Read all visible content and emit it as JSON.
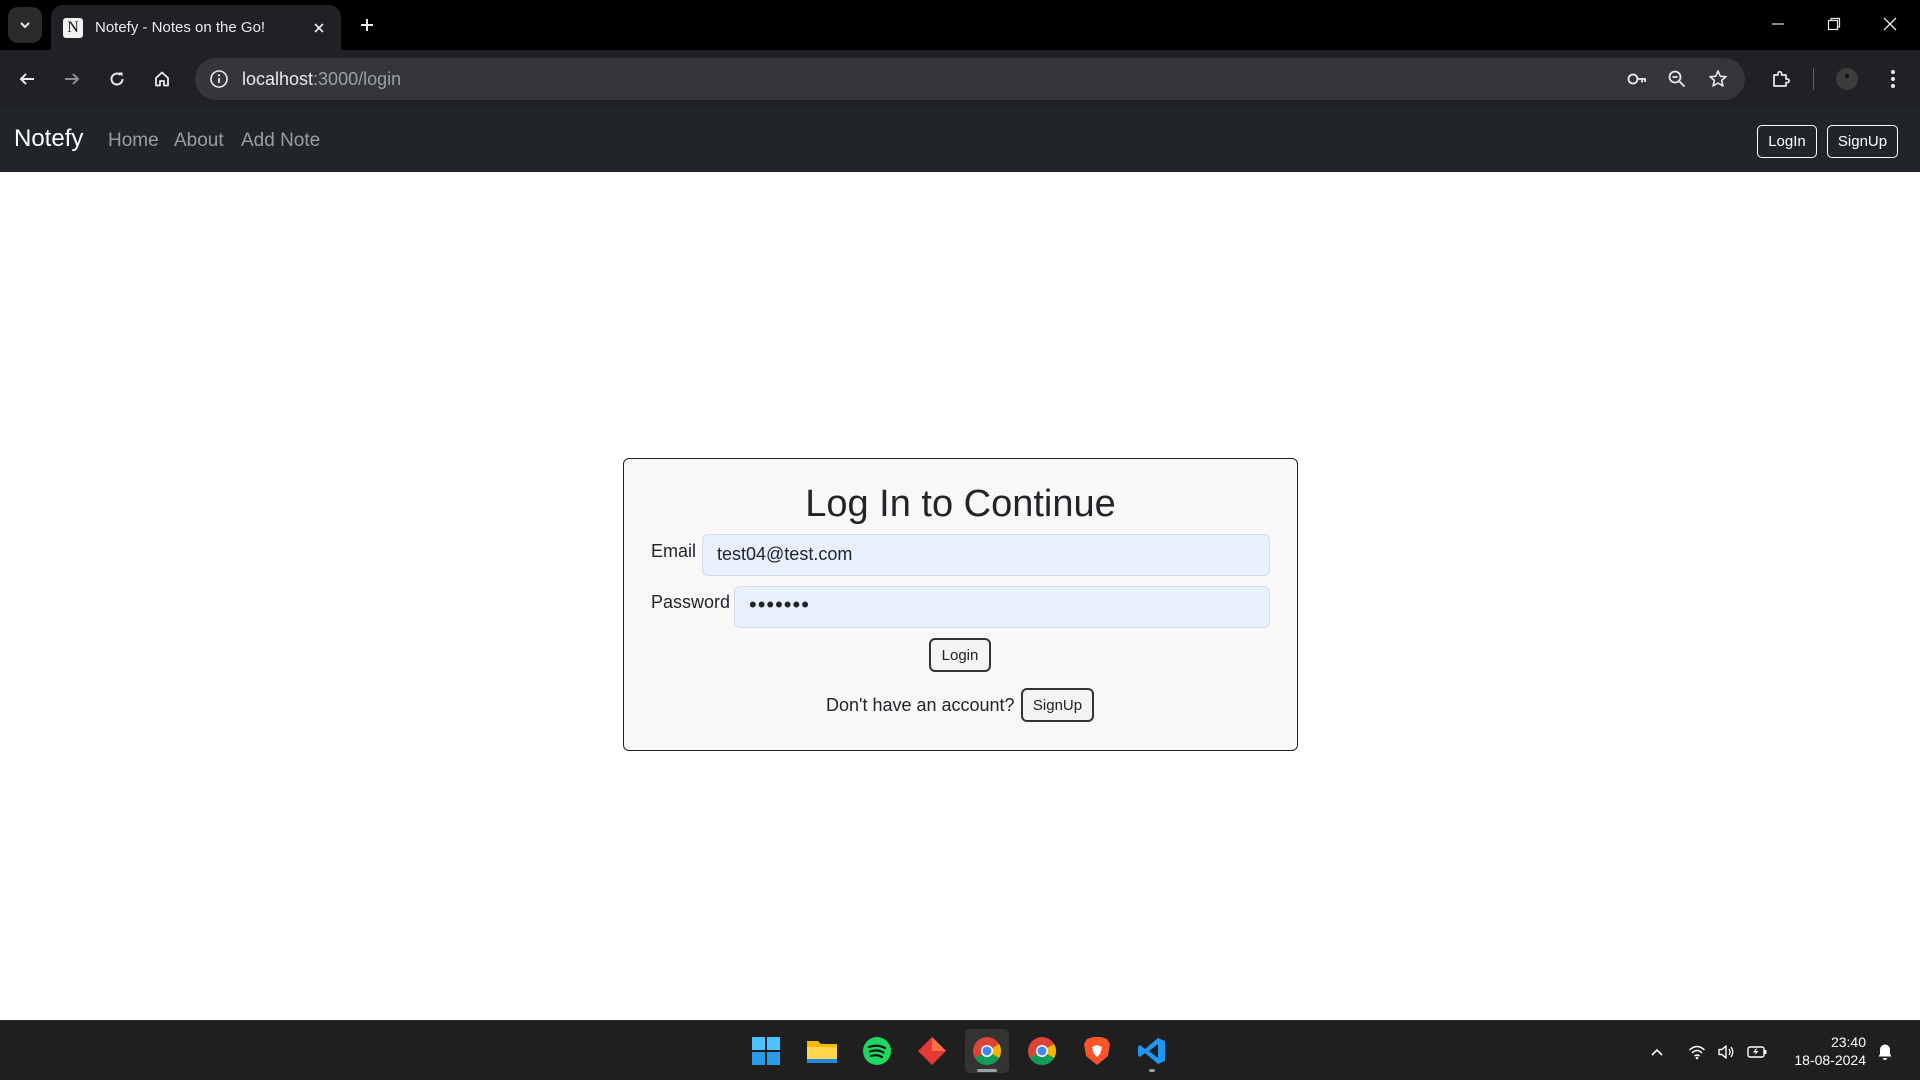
{
  "browser": {
    "tab_title": "Notefy - Notes on the Go!",
    "tab_favicon_letter": "N",
    "url_host": "localhost",
    "url_path": ":3000/login"
  },
  "navbar": {
    "brand": "Notefy",
    "links": [
      "Home",
      "About",
      "Add Note"
    ],
    "login_label": "LogIn",
    "signup_label": "SignUp"
  },
  "login_card": {
    "title": "Log In to Continue",
    "email_label": "Email",
    "email_value": "test04@test.com",
    "password_label": "Password",
    "password_masked": "•••••••",
    "login_button": "Login",
    "signup_prompt": "Don't have an account?",
    "signup_button": "SignUp"
  },
  "taskbar": {
    "apps": [
      "windows-start-icon",
      "file-explorer-icon",
      "spotify-icon",
      "red-diamond-app-icon",
      "chrome-icon",
      "chrome-icon",
      "brave-icon",
      "vscode-icon"
    ],
    "time": "23:40",
    "date": "18-08-2024"
  },
  "colors": {
    "navbar_bg": "#212529",
    "input_autofill_bg": "#e8f0fe",
    "browser_toolbar_bg": "#202124"
  }
}
